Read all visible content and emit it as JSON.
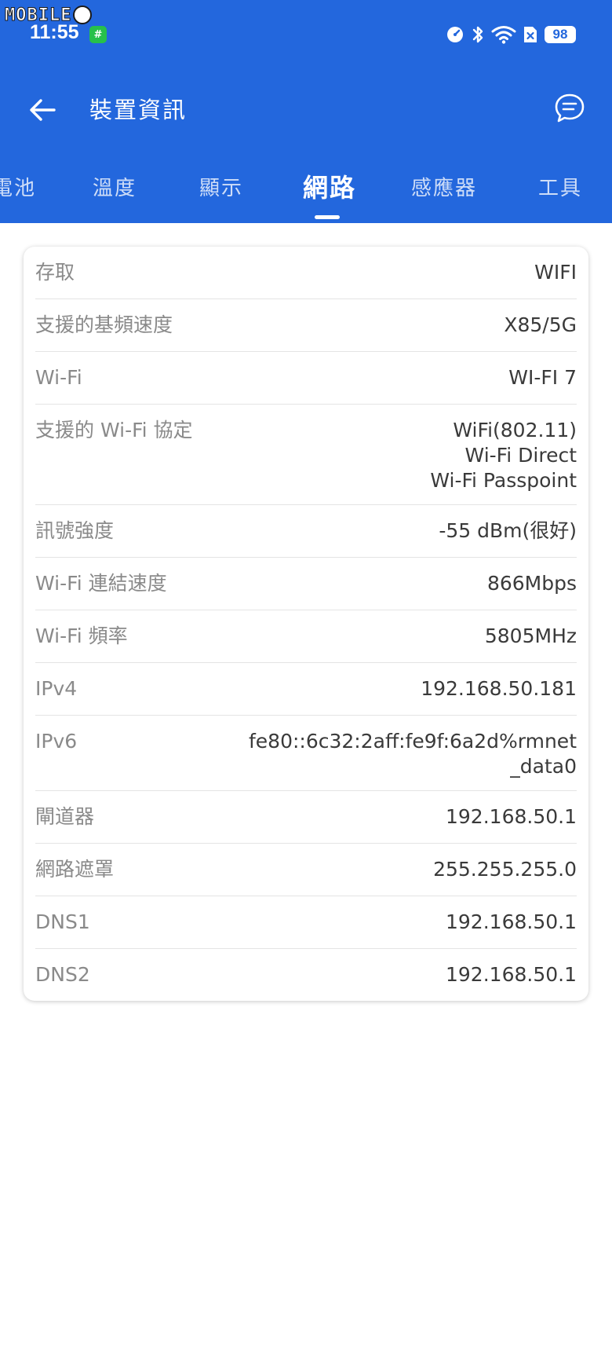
{
  "watermark": {
    "text": "MOBILE"
  },
  "status_bar": {
    "time": "11:55",
    "app_icon_glyph": "#",
    "battery": "98",
    "icons": [
      "speedometer-icon",
      "bluetooth-icon",
      "wifi-icon",
      "no-sim-icon",
      "battery-icon"
    ]
  },
  "toolbar": {
    "title": "裝置資訊"
  },
  "tabs": [
    {
      "label": "電池"
    },
    {
      "label": "溫度"
    },
    {
      "label": "顯示"
    },
    {
      "label": "網路"
    },
    {
      "label": "感應器"
    },
    {
      "label": "工具"
    }
  ],
  "active_tab_index": 3,
  "rows": [
    {
      "label": "存取",
      "value": "WIFI"
    },
    {
      "label": "支援的基頻速度",
      "value": "X85/5G"
    },
    {
      "label": "Wi-Fi",
      "value": "WI-FI 7"
    },
    {
      "label": "支援的 Wi-Fi 協定",
      "value": "WiFi(802.11)\nWi-Fi Direct\nWi-Fi Passpoint"
    },
    {
      "label": "訊號強度",
      "value": "-55 dBm(很好)"
    },
    {
      "label": "Wi-Fi 連結速度",
      "value": "866Mbps"
    },
    {
      "label": "Wi-Fi 頻率",
      "value": "5805MHz"
    },
    {
      "label": "IPv4",
      "value": "192.168.50.181"
    },
    {
      "label": "IPv6",
      "value": "fe80::6c32:2aff:fe9f:6a2d%rmnet_data0"
    },
    {
      "label": "閘道器",
      "value": "192.168.50.1"
    },
    {
      "label": "網路遮罩",
      "value": "255.255.255.0"
    },
    {
      "label": "DNS1",
      "value": "192.168.50.1"
    },
    {
      "label": "DNS2",
      "value": "192.168.50.1"
    }
  ],
  "colors": {
    "primary": "#2367dd",
    "label": "#8a8a8a",
    "value": "#3a3a3a"
  }
}
